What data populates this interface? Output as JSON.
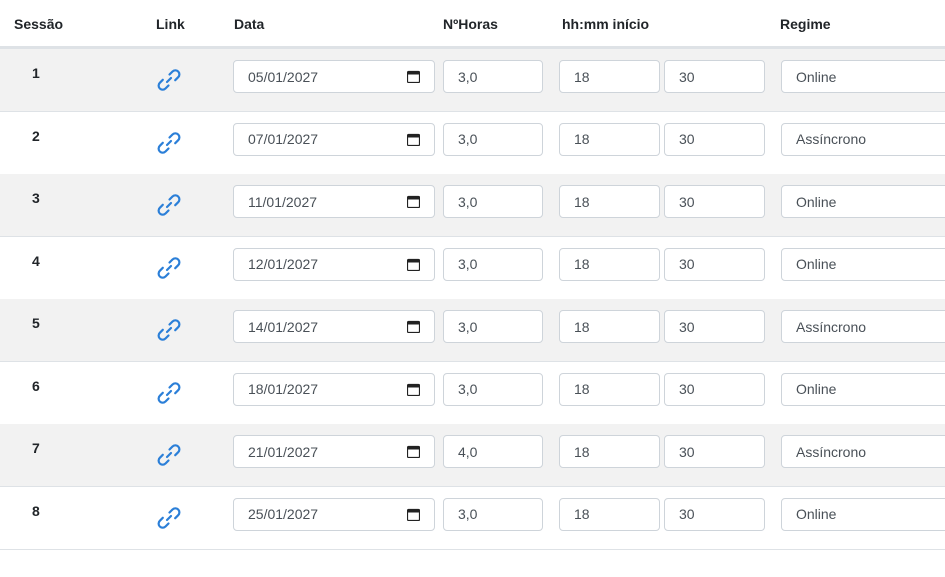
{
  "table": {
    "headers": {
      "sessao": "Sessão",
      "link": "Link",
      "data": "Data",
      "horas": "NºHoras",
      "inicio": "hh:mm início",
      "regime": "Regime"
    },
    "rows": [
      {
        "num": "1",
        "date": "05/01/2027",
        "hours": "3,0",
        "hh": "18",
        "mm": "30",
        "regime": "Online"
      },
      {
        "num": "2",
        "date": "07/01/2027",
        "hours": "3,0",
        "hh": "18",
        "mm": "30",
        "regime": "Assíncrono"
      },
      {
        "num": "3",
        "date": "11/01/2027",
        "hours": "3,0",
        "hh": "18",
        "mm": "30",
        "regime": "Online"
      },
      {
        "num": "4",
        "date": "12/01/2027",
        "hours": "3,0",
        "hh": "18",
        "mm": "30",
        "regime": "Online"
      },
      {
        "num": "5",
        "date": "14/01/2027",
        "hours": "3,0",
        "hh": "18",
        "mm": "30",
        "regime": "Assíncrono"
      },
      {
        "num": "6",
        "date": "18/01/2027",
        "hours": "3,0",
        "hh": "18",
        "mm": "30",
        "regime": "Online"
      },
      {
        "num": "7",
        "date": "21/01/2027",
        "hours": "4,0",
        "hh": "18",
        "mm": "30",
        "regime": "Assíncrono"
      },
      {
        "num": "8",
        "date": "25/01/2027",
        "hours": "3,0",
        "hh": "18",
        "mm": "30",
        "regime": "Online"
      }
    ]
  },
  "colors": {
    "link_icon": "#2b7fd8",
    "stripe": "#f2f2f2",
    "border": "#ced4da"
  },
  "icons": {
    "link": "link-icon",
    "calendar": "calendar-icon"
  }
}
